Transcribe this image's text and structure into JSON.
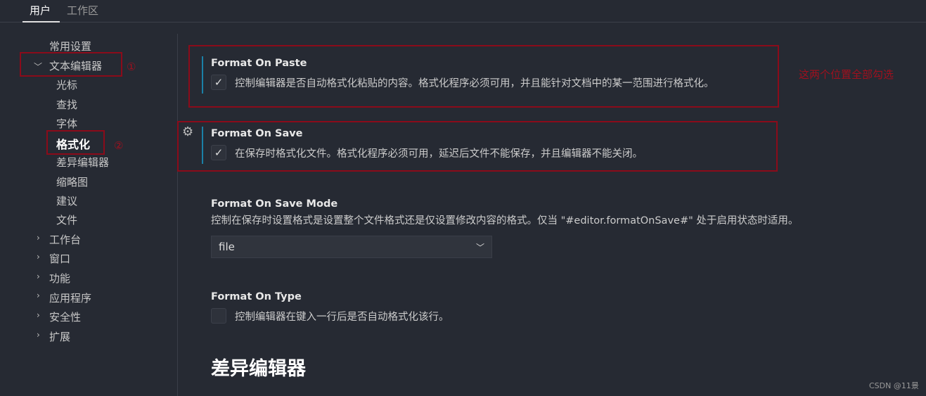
{
  "tabs": [
    {
      "label": "用户",
      "active": true
    },
    {
      "label": "工作区",
      "active": false
    }
  ],
  "nav": {
    "items": [
      "常用设置",
      "文本编辑器",
      "光标",
      "查找",
      "字体",
      "格式化",
      "差异编辑器",
      "缩略图",
      "建议",
      "文件",
      "工作台",
      "窗口",
      "功能",
      "应用程序",
      "安全性",
      "扩展"
    ]
  },
  "annotations": {
    "one": "①",
    "two": "②",
    "note": "这两个位置全部勾选"
  },
  "settings": [
    {
      "title": "Format On Paste",
      "desc": "控制编辑器是否自动格式化粘贴的内容。格式化程序必须可用，并且能针对文档中的某一范围进行格式化。",
      "checked": true
    },
    {
      "title": "Format On Save",
      "desc": "在保存时格式化文件。格式化程序必须可用，延迟后文件不能保存，并且编辑器不能关闭。",
      "checked": true
    },
    {
      "title": "Format On Save Mode",
      "desc": "控制在保存时设置格式是设置整个文件格式还是仅设置修改内容的格式。仅当 \"#editor.formatOnSave#\" 处于启用状态时适用。",
      "value": "file"
    },
    {
      "title": "Format On Type",
      "desc": "控制编辑器在键入一行后是否自动格式化该行。",
      "checked": false
    }
  ],
  "section_heading": "差异编辑器",
  "check_glyph": "✓",
  "watermark": "CSDN @11景",
  "colors": {
    "annotation": "#8b0b1a",
    "accent": "#1b80a6"
  }
}
